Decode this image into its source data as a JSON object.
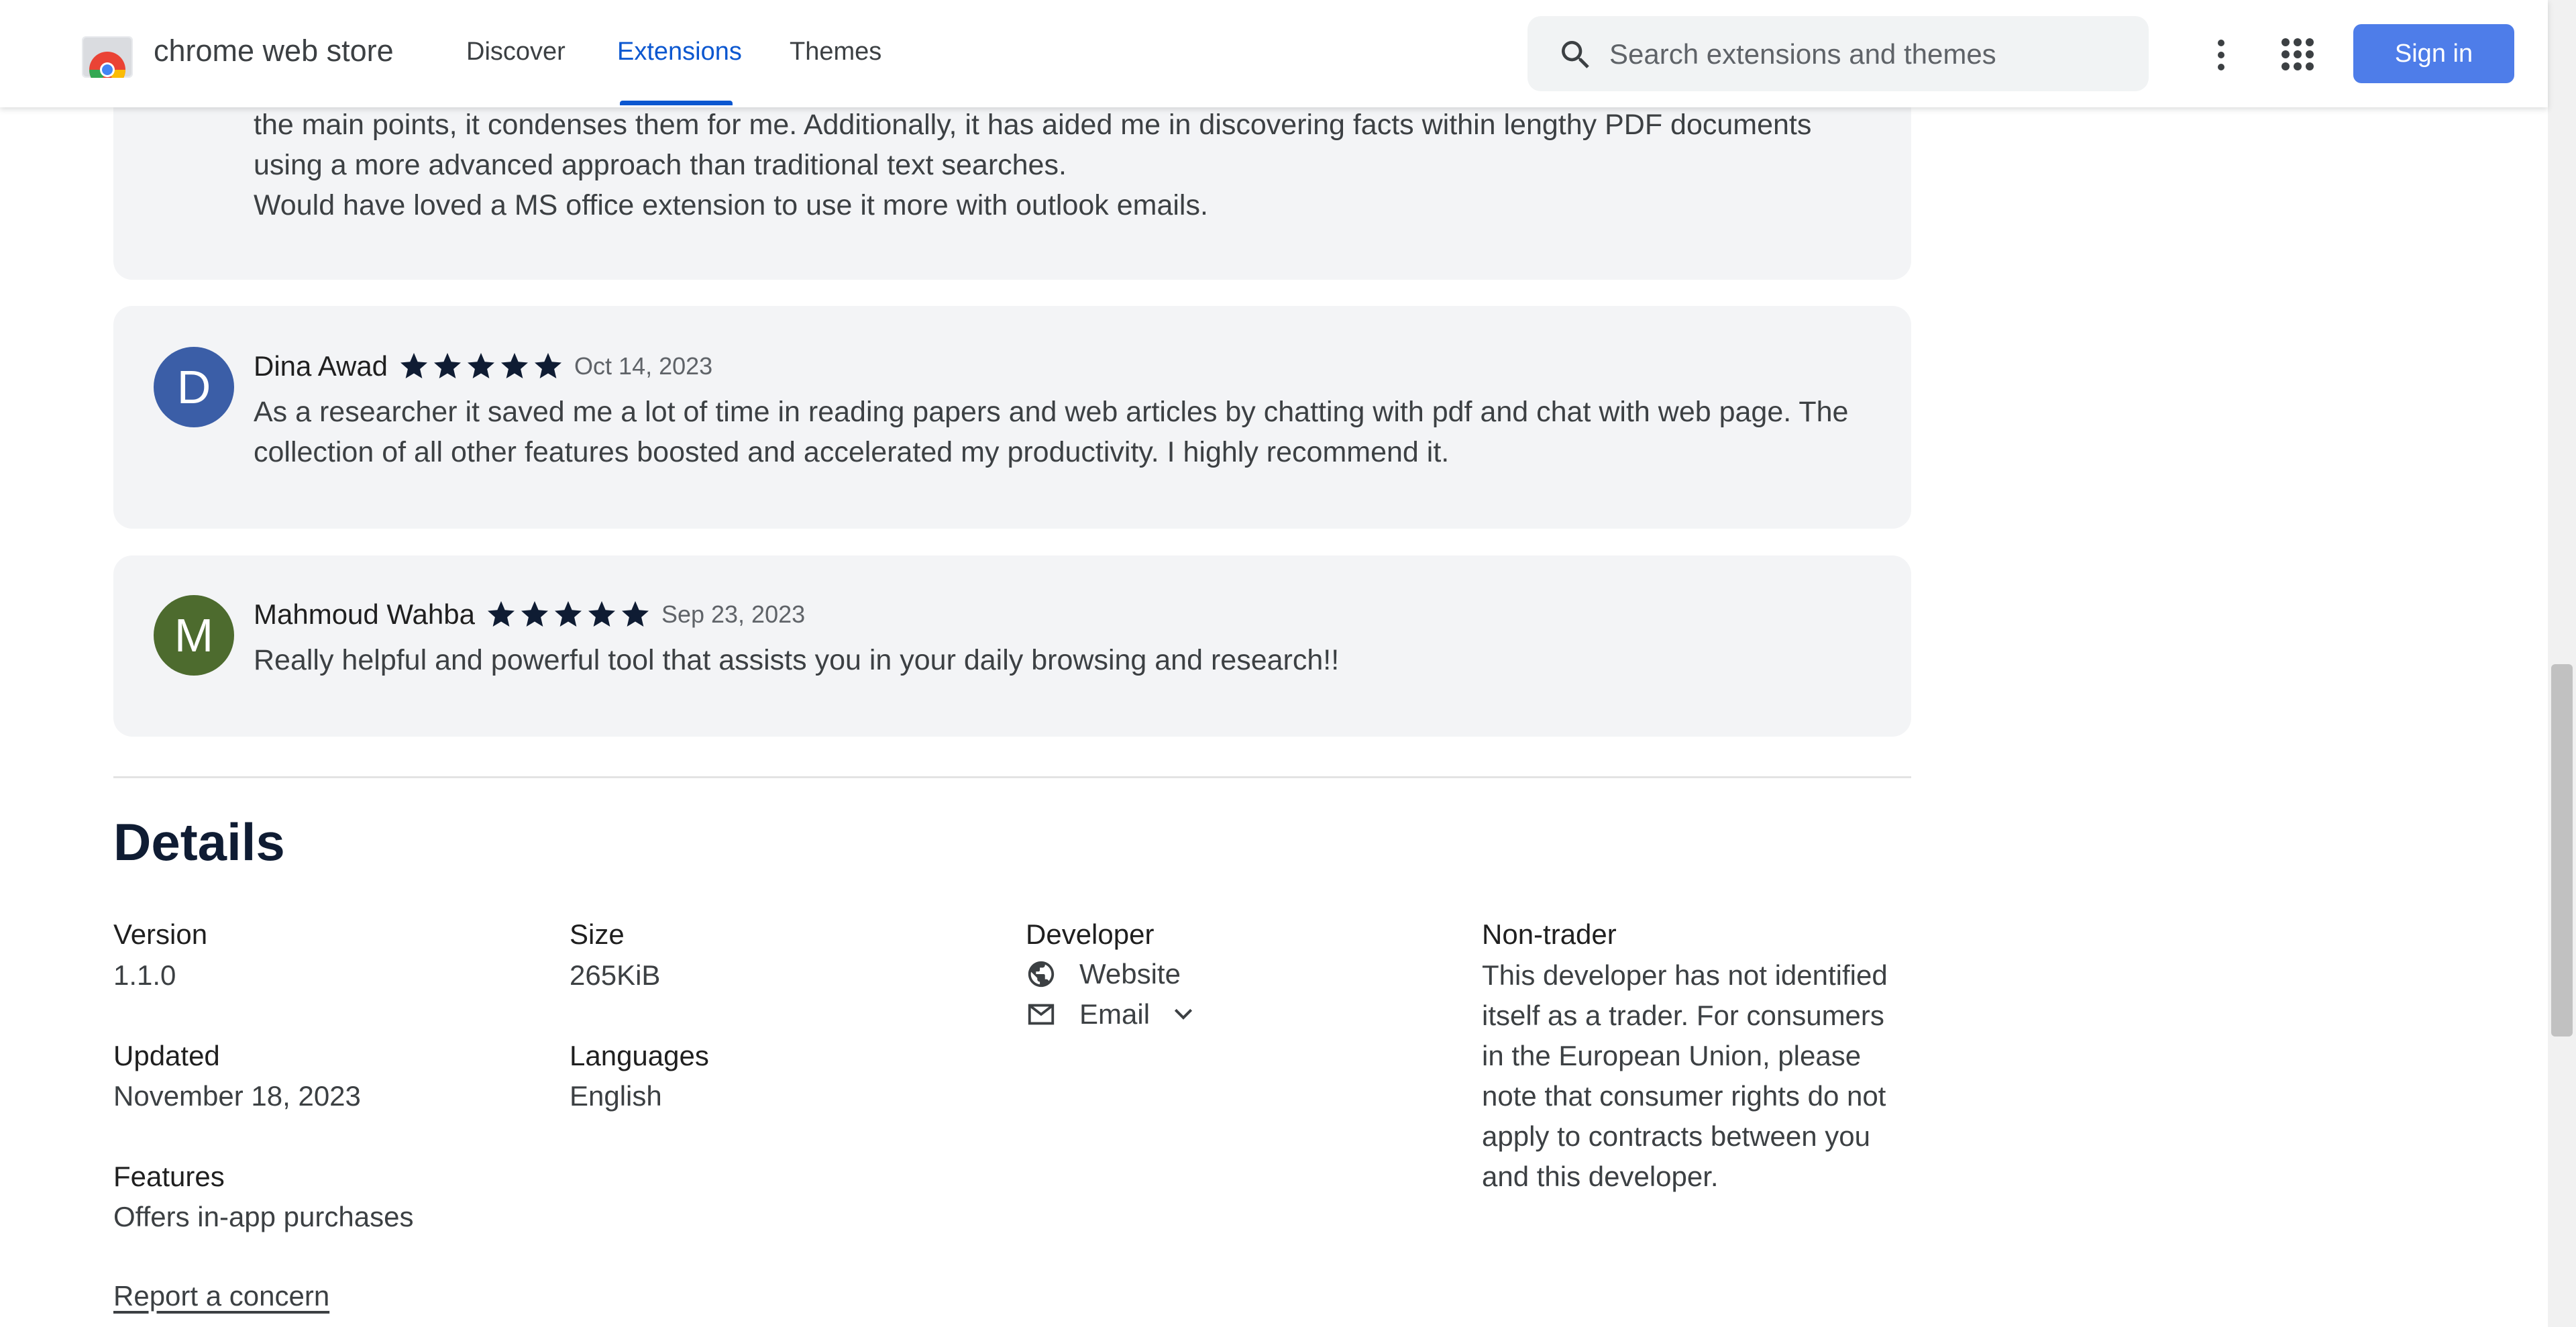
{
  "header": {
    "brand": "chrome web store",
    "nav": [
      "Discover",
      "Extensions",
      "Themes"
    ],
    "active_nav": "Extensions",
    "search_placeholder": "Search extensions and themes",
    "signin_label": "Sign in"
  },
  "reviews": [
    {
      "text_lines": [
        "the main points, it condenses them for me. Additionally, it has aided me in discovering facts within lengthy PDF documents",
        "using a more advanced approach than traditional text searches.",
        "Would have loved a MS office extension to use it more with outlook emails."
      ]
    },
    {
      "avatar_letter": "D",
      "avatar_color": "#3b5ea7",
      "name": "Dina Awad",
      "rating": 5,
      "date": "Oct 14, 2023",
      "text_lines": [
        "As a researcher it saved me a lot of time in reading papers and web articles by chatting with pdf and chat with web page. The",
        "collection of all other features boosted and accelerated my productivity. I highly recommend it."
      ]
    },
    {
      "avatar_letter": "M",
      "avatar_color": "#4d6b2e",
      "name": "Mahmoud Wahba",
      "rating": 5,
      "date": "Sep 23, 2023",
      "text_lines": [
        "Really helpful and powerful tool that assists you in your daily browsing and research!!"
      ]
    }
  ],
  "details": {
    "title": "Details",
    "version_label": "Version",
    "version_value": "1.1.0",
    "updated_label": "Updated",
    "updated_value": "November 18, 2023",
    "features_label": "Features",
    "features_value": "Offers in-app purchases",
    "size_label": "Size",
    "size_value": "265KiB",
    "languages_label": "Languages",
    "languages_value": "English",
    "developer_label": "Developer",
    "website_label": "Website",
    "email_label": "Email",
    "trader_label": "Non-trader",
    "trader_text": "This developer has not identified itself as a trader. For consumers in the European Union, please note that consumer rights do not apply to contracts between you and this developer.",
    "report_label": "Report a concern"
  },
  "colors": {
    "accent": "#0b57d0",
    "signin_bg": "#4e7de9",
    "card_bg": "#f3f4f6",
    "star": "#0f1c33"
  },
  "icons": [
    "chrome-web-store-logo",
    "search-icon",
    "more-vert-icon",
    "apps-grid-icon",
    "star-icon",
    "globe-icon",
    "mail-icon",
    "chevron-down-icon"
  ]
}
